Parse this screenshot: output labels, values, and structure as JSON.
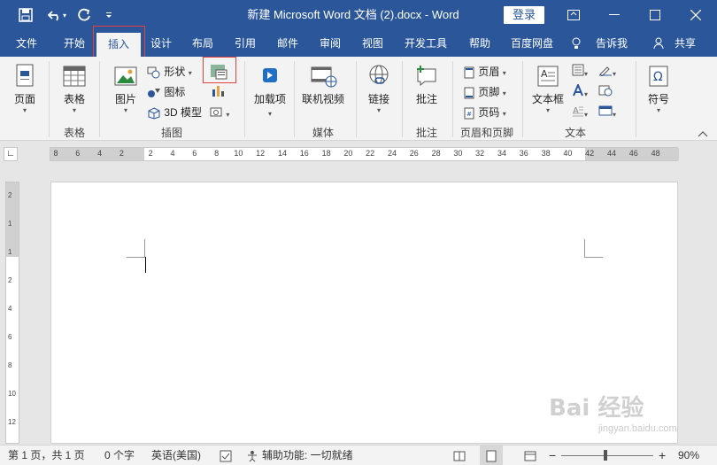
{
  "titlebar": {
    "title": "新建 Microsoft Word 文档 (2).docx  -  Word",
    "login_label": "登录",
    "save_icon": "save-icon",
    "undo_icon": "undo-icon",
    "redo_icon": "redo-icon",
    "customize_icon": "chevron-down-icon"
  },
  "tabs": [
    {
      "label": "文件"
    },
    {
      "label": "开始"
    },
    {
      "label": "插入"
    },
    {
      "label": "设计"
    },
    {
      "label": "布局"
    },
    {
      "label": "引用"
    },
    {
      "label": "邮件"
    },
    {
      "label": "审阅"
    },
    {
      "label": "视图"
    },
    {
      "label": "开发工具"
    },
    {
      "label": "帮助"
    },
    {
      "label": "百度网盘"
    },
    {
      "label": "告诉我"
    },
    {
      "label": "共享"
    }
  ],
  "active_tab": "插入",
  "ribbon": {
    "page_label": "页面",
    "table_label": "表格",
    "table_group": "表格",
    "picture_label": "图片",
    "shapes_label": "形状",
    "icons_label": "图标",
    "model3d_label": "3D 模型",
    "illustrations_group": "插图",
    "addins_label": "加载项",
    "online_video_label": "联机视频",
    "media_group": "媒体",
    "link_label": "链接",
    "comment_label": "批注",
    "comment_group": "批注",
    "header_label": "页眉",
    "footer_label": "页脚",
    "page_number_label": "页码",
    "header_footer_group": "页眉和页脚",
    "textbox_label": "文本框",
    "text_group": "文本",
    "symbol_label": "符号"
  },
  "ruler": {
    "numbers": [
      "8",
      "6",
      "4",
      "2",
      "2",
      "4",
      "6",
      "8",
      "10",
      "12",
      "14",
      "16",
      "18",
      "20",
      "22",
      "24",
      "26",
      "28",
      "30",
      "32",
      "34",
      "36",
      "38",
      "40",
      "42",
      "44",
      "46",
      "48"
    ]
  },
  "vruler": {
    "numbers": [
      "2",
      "1",
      "1",
      "2",
      "4",
      "6",
      "8",
      "10",
      "12"
    ]
  },
  "statusbar": {
    "page_info": "第 1 页，共 1 页",
    "word_count": "0 个字",
    "language": "英语(美国)",
    "accessibility": "辅助功能: 一切就绪",
    "zoom": "90%"
  },
  "watermark": {
    "text": "Bai 经验",
    "url": "jingyan.baidu.com"
  },
  "colors": {
    "brand": "#2b579a",
    "highlight": "#e8403a"
  }
}
